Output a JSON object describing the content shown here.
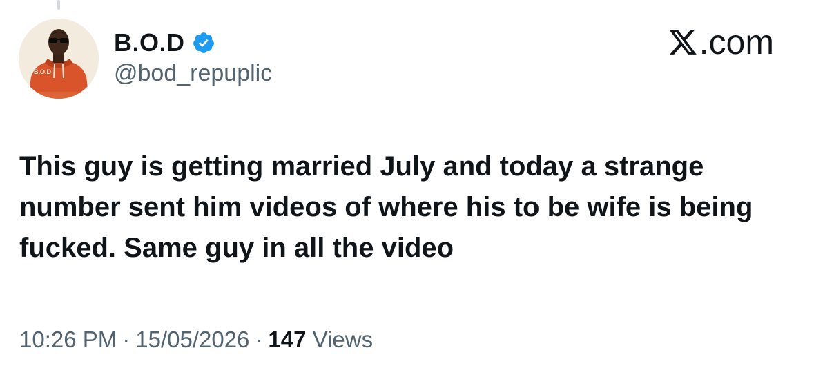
{
  "tweet": {
    "author": {
      "display_name": "B.O.D",
      "handle": "@bod_repuplic",
      "verified": true,
      "verified_color": "#1d9bf0",
      "avatar_text": "B.O.D"
    },
    "brand": {
      "label": ".com",
      "logo_icon": "x-logo-icon"
    },
    "text": "This guy is getting married July and today a strange number sent him videos of where his to be wife is being fucked. Same guy in all the video",
    "time": "10:26 PM",
    "separator": "·",
    "date": "15/05/2026",
    "views_count": "147",
    "views_label": "Views"
  }
}
